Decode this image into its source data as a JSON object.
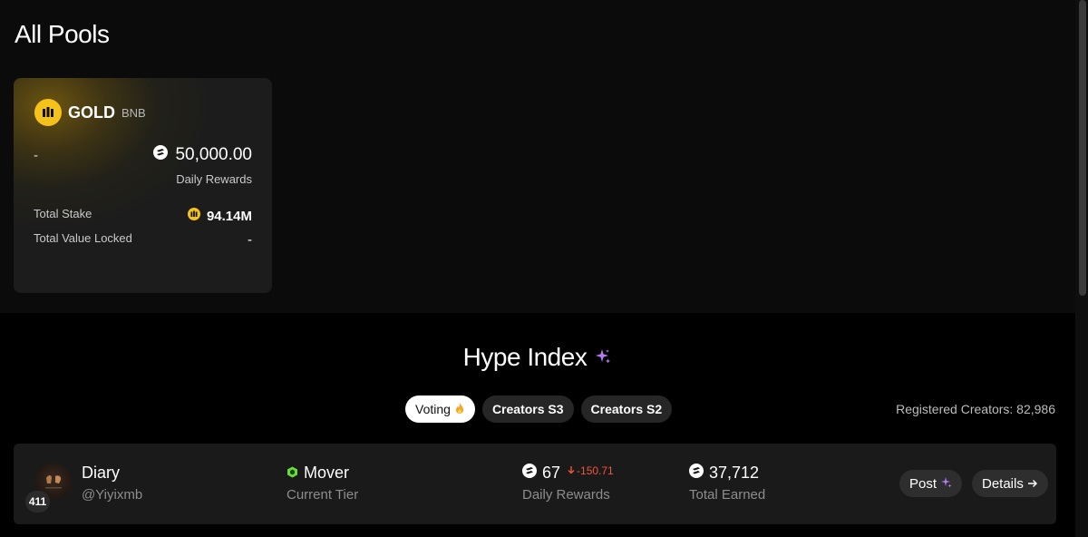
{
  "page": {
    "title": "All Pools"
  },
  "pool": {
    "name": "GOLD",
    "chain": "BNB",
    "apr": "-",
    "daily_rewards_value": "50,000.00",
    "daily_rewards_label": "Daily Rewards",
    "total_stake_label": "Total Stake",
    "total_stake_value": "94.14M",
    "tvl_label": "Total Value Locked",
    "tvl_value": "-",
    "icon": "gold-token-icon",
    "reward_icon": "reward-token-icon",
    "brand_color": "#f4c21b"
  },
  "hype": {
    "title": "Hype Index",
    "title_icon": "sparkle-icon",
    "tabs": [
      {
        "label": "Voting",
        "icon": "fire-icon",
        "active": true
      },
      {
        "label": "Creators S3",
        "active": false
      },
      {
        "label": "Creators S2",
        "active": false
      }
    ],
    "registered_creators": "Registered Creators: 82,986"
  },
  "creator": {
    "rank": "411",
    "name": "Diary",
    "handle": "@Yiyixmb",
    "tier": "Mover",
    "tier_label": "Current Tier",
    "daily_rewards": "67",
    "daily_change": "-150.71",
    "daily_label": "Daily Rewards",
    "total_earned": "37,712",
    "total_earned_label": "Total Earned",
    "post_label": "Post",
    "details_label": "Details",
    "change_color": "#f0553d",
    "tier_color": "#6bdc3a"
  }
}
